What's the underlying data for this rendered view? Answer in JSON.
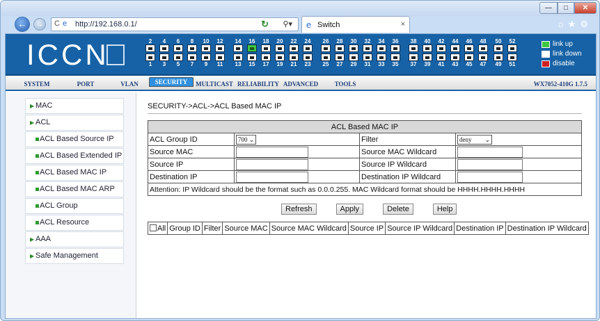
{
  "browser": {
    "url": "http://192.168.0.1/",
    "tab_title": "Switch",
    "close_tab": "×",
    "window_min": "—",
    "window_max": "□",
    "window_close": "✕"
  },
  "banner": {
    "logo": "ICCN",
    "ports_top": [
      "2",
      "4",
      "6",
      "8",
      "10",
      "12",
      "14",
      "16",
      "18",
      "20",
      "22",
      "24",
      "26",
      "28",
      "30",
      "32",
      "34",
      "36",
      "38",
      "40",
      "42",
      "44",
      "46",
      "48",
      "50",
      "52"
    ],
    "ports_bottom": [
      "1",
      "3",
      "5",
      "7",
      "9",
      "11",
      "13",
      "15",
      "17",
      "19",
      "21",
      "23",
      "25",
      "27",
      "29",
      "31",
      "33",
      "35",
      "37",
      "39",
      "41",
      "43",
      "45",
      "47",
      "49",
      "51"
    ],
    "legend": {
      "up": "link up",
      "down": "link down",
      "disable": "disable"
    },
    "colors": {
      "up": "#3fc83f",
      "down": "#ffffff",
      "disable": "#d02020"
    }
  },
  "menu": {
    "items": [
      "SYSTEM",
      "PORT",
      "VLAN",
      "SECURITY",
      "MULTICAST",
      "RELIABILITY",
      "ADVANCED",
      "TOOLS"
    ],
    "selected": "SECURITY",
    "version": "WX7052-410G 1.7.5"
  },
  "sidebar": {
    "items": [
      "MAC",
      "ACL",
      "ACL Based Source IP",
      "ACL Based Extended IP",
      "ACL Based MAC IP",
      "ACL Based MAC ARP",
      "ACL Group",
      "ACL Resource",
      "AAA",
      "Safe Management"
    ]
  },
  "main": {
    "breadcrumb": "SECURITY->ACL->ACL Based MAC IP",
    "form_title": "ACL Based MAC IP",
    "acl_group_label": "ACL Group ID",
    "acl_group_value": "700",
    "filter_label": "Filter",
    "filter_value": "deny",
    "source_mac": "Source MAC",
    "source_mac_wildcard": "Source MAC Wildcard",
    "source_ip": "Source IP",
    "source_ip_wildcard": "Source IP Wildcard",
    "destination_ip": "Destination IP",
    "destination_ip_wildcard": "Destination IP Wildcard",
    "attention": "Attention: IP Wildcard should be the format such as 0.0.0.255. MAC Wildcard format should be HHHH.HHHH.HHHH",
    "buttons": {
      "refresh": "Refresh",
      "apply": "Apply",
      "delete": "Delete",
      "help": "Help"
    },
    "columns": [
      "All",
      "Group ID",
      "Filter",
      "Source MAC",
      "Source MAC Wildcard",
      "Source IP",
      "Source IP Wildcard",
      "Destination IP",
      "Destination IP Wildcard"
    ]
  }
}
